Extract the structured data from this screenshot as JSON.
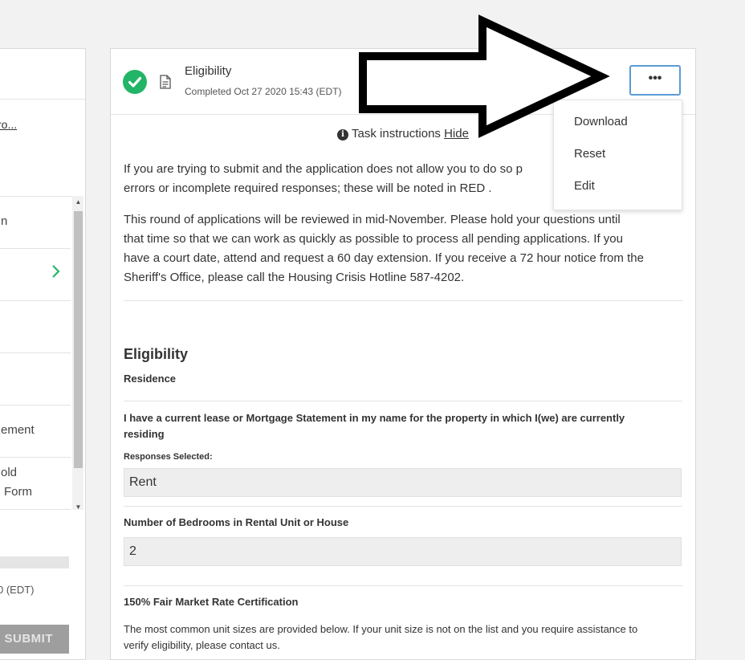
{
  "left_panel": {
    "link_text": "ro...",
    "list_items": [
      {
        "label": "n"
      },
      {
        "label": ""
      },
      {
        "label": ""
      },
      {
        "label": ""
      },
      {
        "label": "ement"
      },
      {
        "label_line1": "old",
        "label_line2": "Form"
      }
    ],
    "date_text": "0 (EDT)",
    "submit_label": "SUBMIT"
  },
  "task": {
    "title": "Eligibility",
    "subtitle": "Completed Oct 27 2020 15:43 (EDT)",
    "more_label": "•••"
  },
  "instructions": {
    "label": "Task instructions",
    "hide_label": "Hide",
    "info_glyph": "i"
  },
  "paragraphs": {
    "p1_line1": "If you are trying to submit and the application does not allow you to do so p",
    "p1_line2": "errors or incomplete required responses; these will be noted in RED .",
    "p2_line1": "This round of applications will be reviewed in mid-November.  Please hold your questions until",
    "p2_line2": "that time so that we can work as quickly as possible to process all pending applications.  If you",
    "p2_line3": "have a court date, attend and request a 60 day extension.  If you receive a 72 hour notice from the",
    "p2_line4": "Sheriff's Office, please call the Housing Crisis Hotline 587-4202."
  },
  "form": {
    "section_title": "Eligibility",
    "subsection": "Residence",
    "q1_line1": "I have a current lease or Mortgage Statement in my name for the property in which I(we) are currently",
    "q1_line2": "residing",
    "responses_label": "Responses Selected:",
    "q1_answer": "Rent",
    "q2_label": "Number of Bedrooms in Rental Unit or House",
    "q2_answer": "2",
    "q3_label": "150% Fair Market Rate Certification",
    "q3_line1": "The most common unit sizes are provided below. If your unit size is not on the list and you require assistance to",
    "q3_line2": "verify eligibility, please contact us."
  },
  "dropdown": {
    "items": [
      "Download",
      "Reset",
      "Edit"
    ]
  },
  "colors": {
    "accent_green": "#23b567",
    "focus_blue": "#5b9bd5",
    "submit_disabled": "#9e9e9e"
  }
}
